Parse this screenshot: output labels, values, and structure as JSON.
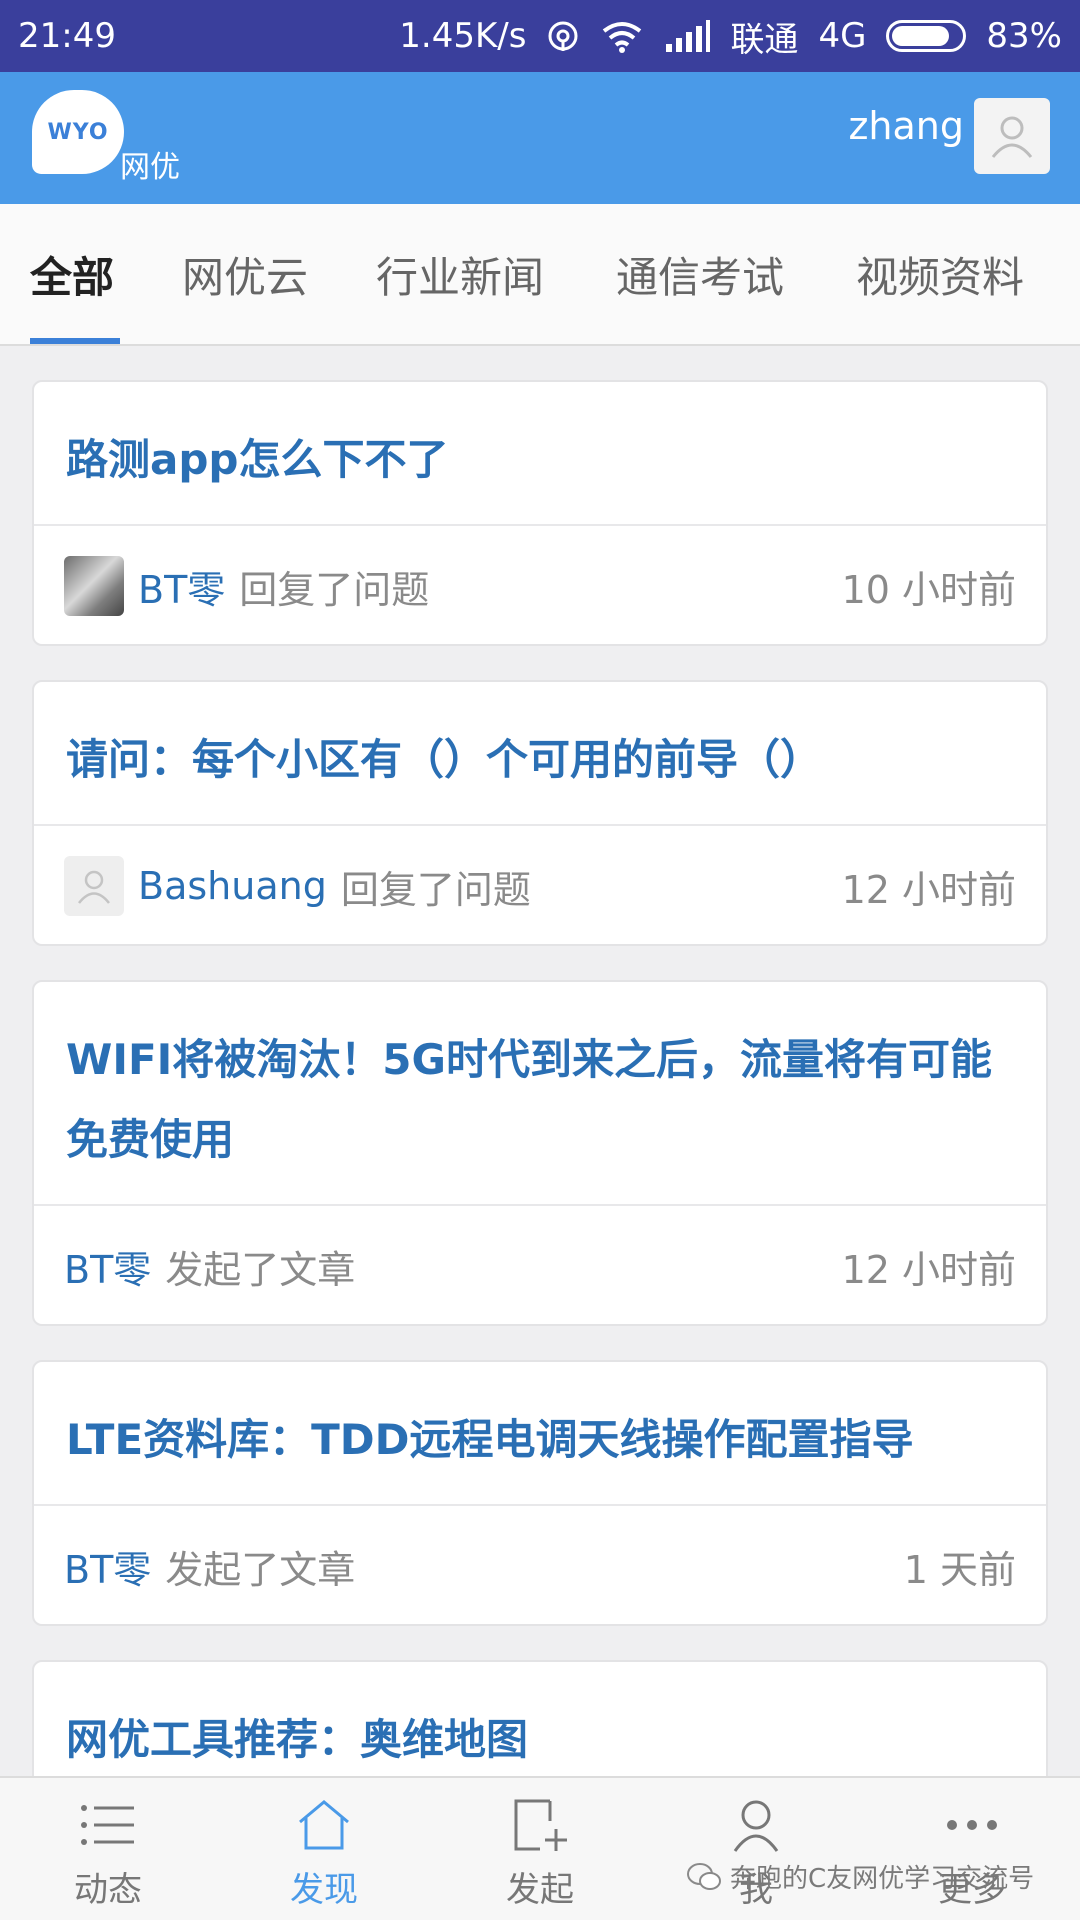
{
  "statusbar": {
    "time": "21:49",
    "speed": "1.45K/s",
    "carrier": "联通",
    "network": "4G",
    "battery": "83%",
    "battery_level": 0.83
  },
  "header": {
    "logo_text": "WYO",
    "logo_sub": "网优",
    "username": "zhang"
  },
  "tabs": [
    {
      "label": "全部",
      "active": true
    },
    {
      "label": "网优云"
    },
    {
      "label": "行业新闻"
    },
    {
      "label": "通信考试"
    },
    {
      "label": "视频资料"
    }
  ],
  "feed": [
    {
      "title": "路测app怎么下不了",
      "user": "BT零",
      "action": "回复了问题",
      "time": "10 小时前",
      "avatar": "photo"
    },
    {
      "title": "请问：每个小区有（）个可用的前导（）",
      "user": "Bashuang",
      "action": "回复了问题",
      "time": "12 小时前",
      "avatar": "default"
    },
    {
      "title": "WIFI将被淘汰！5G时代到来之后，流量将有可能免费使用",
      "user": "BT零",
      "action": "发起了文章",
      "time": "12 小时前",
      "avatar": "none"
    },
    {
      "title": "LTE资料库：TDD远程电调天线操作配置指导",
      "user": "BT零",
      "action": "发起了文章",
      "time": "1 天前",
      "avatar": "none"
    },
    {
      "title": "网优工具推荐：奥维地图",
      "user": "",
      "action": "",
      "time": "",
      "avatar": "none"
    }
  ],
  "bottomnav": [
    {
      "label": "动态",
      "icon": "list-icon"
    },
    {
      "label": "发现",
      "icon": "home-icon",
      "active": true
    },
    {
      "label": "发起",
      "icon": "new-post-icon"
    },
    {
      "label": "我",
      "icon": "person-icon"
    },
    {
      "label": "更多",
      "icon": "more-icon"
    }
  ],
  "watermark": "奔跑的C友网优学习交流号"
}
